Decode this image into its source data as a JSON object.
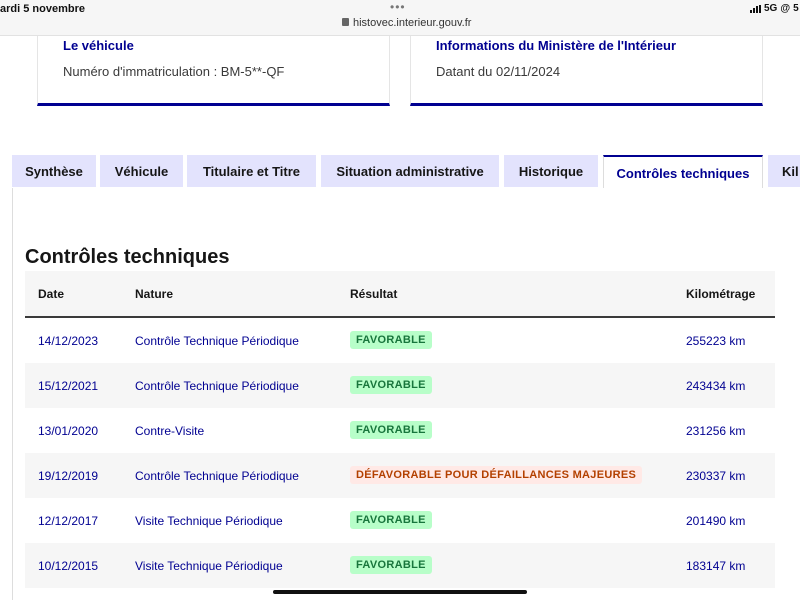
{
  "statusbar": {
    "date": "ardi 5 novembre",
    "dots": "•••",
    "url": "histovec.interieur.gouv.fr",
    "network": "5G",
    "extra": "@",
    "battery": "5"
  },
  "cards": [
    {
      "title": "Le véhicule",
      "text": "Numéro d'immatriculation : BM-5**-QF"
    },
    {
      "title": "Informations du Ministère de l'Intérieur",
      "text": "Datant du 02/11/2024"
    }
  ],
  "tabs": [
    {
      "label": "Synthèse",
      "active": false
    },
    {
      "label": "Véhicule",
      "active": false
    },
    {
      "label": "Titulaire et Titre",
      "active": false
    },
    {
      "label": "Situation administrative",
      "active": false
    },
    {
      "label": "Historique",
      "active": false
    },
    {
      "label": "Contrôles techniques",
      "active": true
    },
    {
      "label": "Kil",
      "active": false
    }
  ],
  "section_title": "Contrôles techniques",
  "table": {
    "headers": {
      "date": "Date",
      "nature": "Nature",
      "result": "Résultat",
      "km": "Kilométrage"
    },
    "rows": [
      {
        "date": "14/12/2023",
        "nature": "Contrôle Technique Périodique",
        "result": "FAVORABLE",
        "status": "ok",
        "km": "255223 km"
      },
      {
        "date": "15/12/2021",
        "nature": "Contrôle Technique Périodique",
        "result": "FAVORABLE",
        "status": "ok",
        "km": "243434 km"
      },
      {
        "date": "13/01/2020",
        "nature": "Contre-Visite",
        "result": "FAVORABLE",
        "status": "ok",
        "km": "231256 km"
      },
      {
        "date": "19/12/2019",
        "nature": "Contrôle Technique Périodique",
        "result": "DÉFAVORABLE POUR DÉFAILLANCES MAJEURES",
        "status": "ko",
        "km": "230337 km"
      },
      {
        "date": "12/12/2017",
        "nature": "Visite Technique Périodique",
        "result": "FAVORABLE",
        "status": "ok",
        "km": "201490 km"
      },
      {
        "date": "10/12/2015",
        "nature": "Visite Technique Périodique",
        "result": "FAVORABLE",
        "status": "ok",
        "km": "183147 km"
      }
    ]
  },
  "colors": {
    "brand_blue": "#000091",
    "tab_bg": "#e3e3fd",
    "ok_bg": "#b8fec9",
    "ok_text": "#18753c",
    "ko_bg": "#ffe9e6",
    "ko_text": "#b34000"
  }
}
